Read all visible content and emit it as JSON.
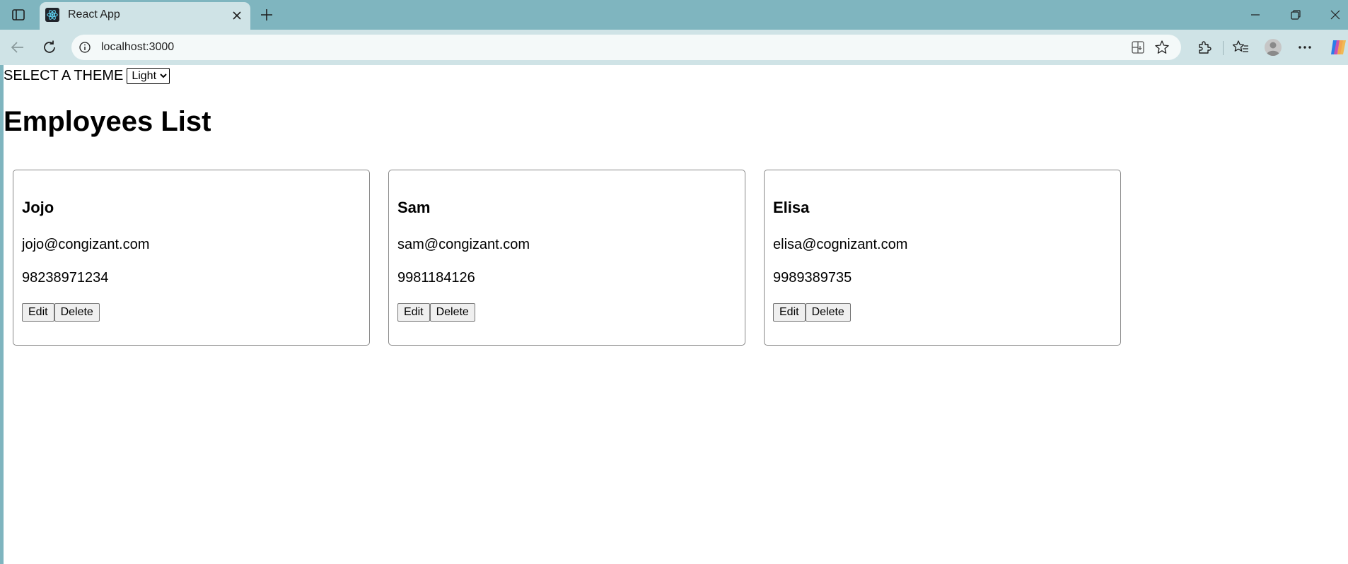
{
  "browser": {
    "tab_title": "React App",
    "url": "localhost:3000",
    "icons": {
      "sidebar": "sidebar-icon",
      "favicon": "react-icon",
      "tab_close": "close-icon",
      "new_tab": "plus-icon",
      "minimize": "minimize-icon",
      "restore": "restore-icon",
      "close": "close-icon",
      "back": "back-arrow-icon",
      "reload": "reload-icon",
      "site_info": "info-icon",
      "app": "app-icon",
      "favorite": "star-icon",
      "extensions": "puzzle-icon",
      "favorites": "favorites-icon",
      "profile": "profile-icon",
      "more": "more-icon",
      "copilot": "copilot-icon"
    }
  },
  "page": {
    "theme_label": "SELECT A THEME",
    "theme_selected": "Light",
    "title": "Employees List",
    "edit_label": "Edit",
    "delete_label": "Delete",
    "employees": [
      {
        "name": "Jojo",
        "email": "jojo@congizant.com",
        "phone": "98238971234"
      },
      {
        "name": "Sam",
        "email": "sam@congizant.com",
        "phone": "9981184126"
      },
      {
        "name": "Elisa",
        "email": "elisa@cognizant.com",
        "phone": "9989389735"
      }
    ]
  }
}
